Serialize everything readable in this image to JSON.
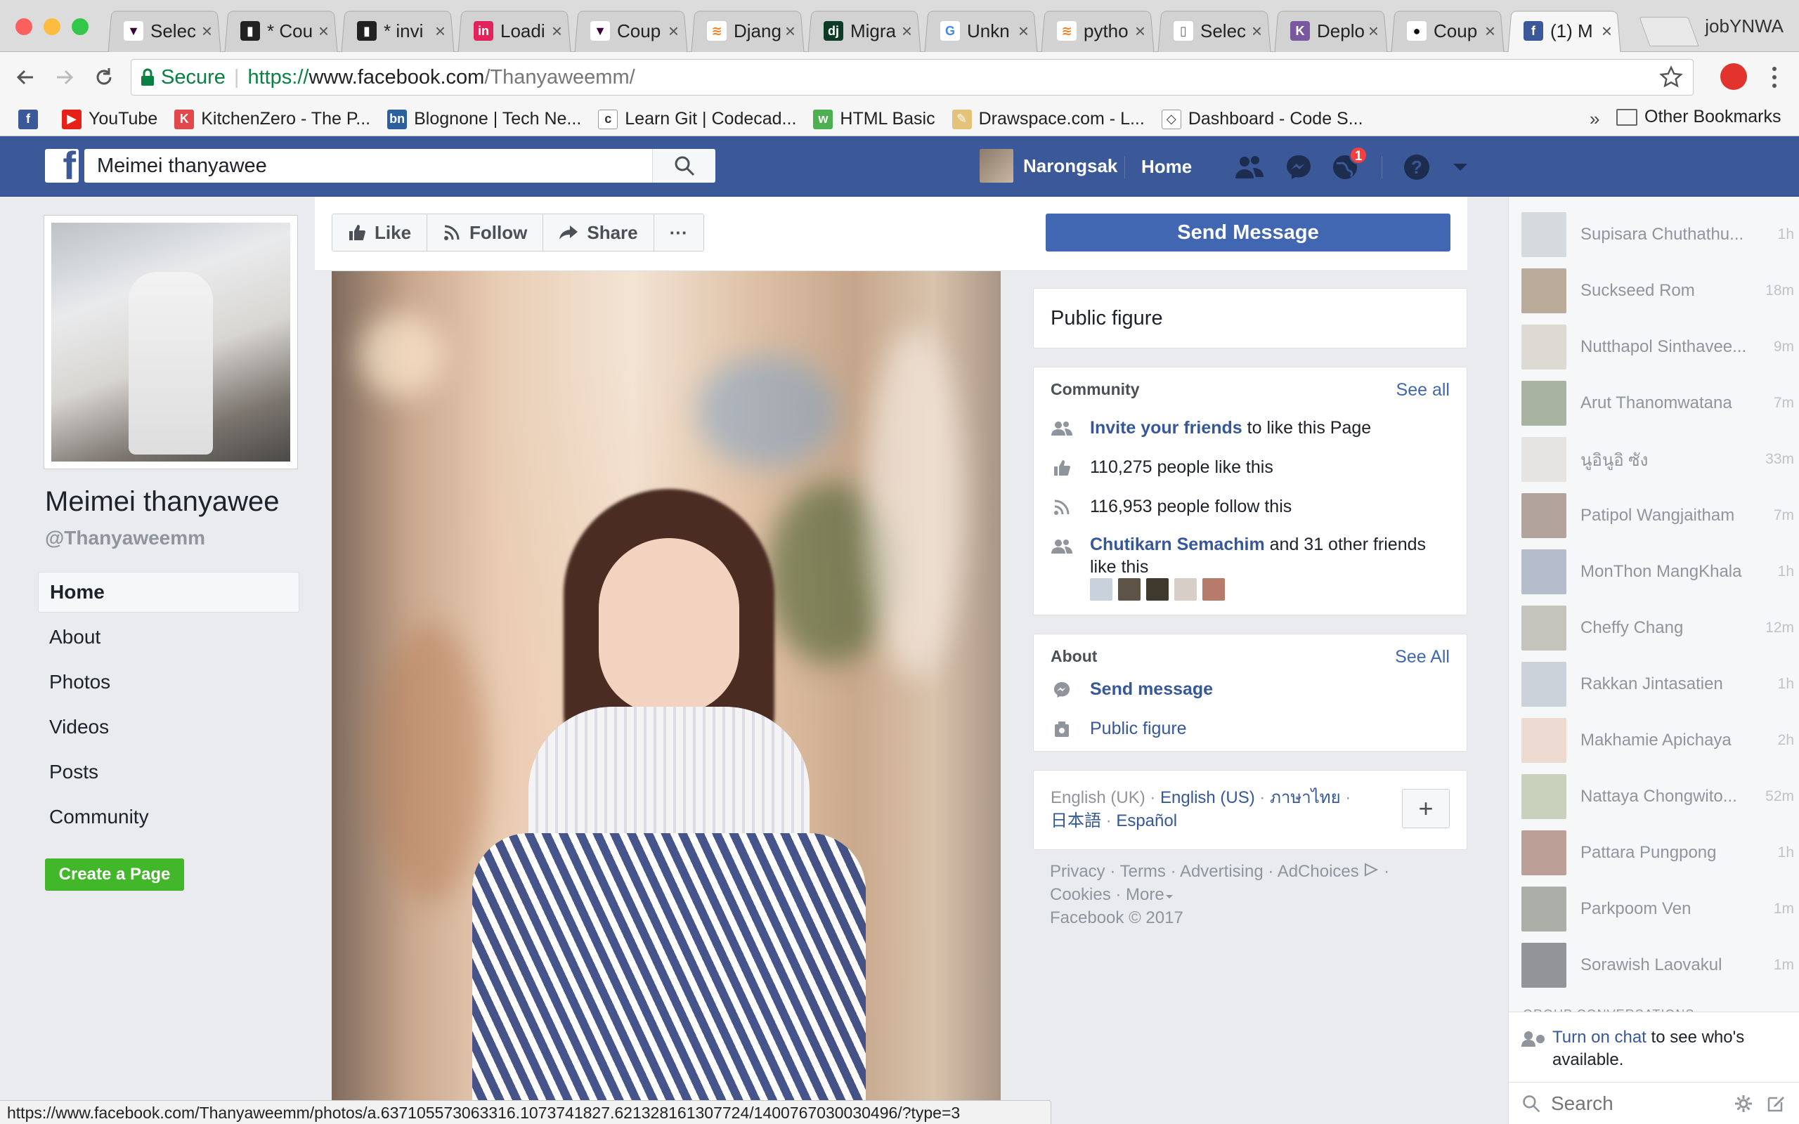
{
  "browser": {
    "profile_name": "jobYNWA",
    "tabs": [
      {
        "title": "Selec",
        "favicon": "fpl-icon",
        "color": "#ffffff",
        "fg": "#37003c",
        "glyph": "▼"
      },
      {
        "title": "* Cou",
        "favicon": "toggl-icon",
        "color": "#222222",
        "fg": "#ffffff",
        "glyph": "▮"
      },
      {
        "title": "* invi",
        "favicon": "toggl-icon",
        "color": "#222222",
        "fg": "#ffffff",
        "glyph": "▮"
      },
      {
        "title": "Loadi",
        "favicon": "invision-icon",
        "color": "#e3245c",
        "fg": "#ffffff",
        "glyph": "in"
      },
      {
        "title": "Coup",
        "favicon": "fpl-icon",
        "color": "#ffffff",
        "fg": "#37003c",
        "glyph": "▼"
      },
      {
        "title": "Djang",
        "favicon": "stackoverflow-icon",
        "color": "#ffffff",
        "fg": "#f48024",
        "glyph": "≋"
      },
      {
        "title": "Migra",
        "favicon": "django-icon",
        "color": "#0c3c26",
        "fg": "#ffffff",
        "glyph": "dj"
      },
      {
        "title": "Unkn",
        "favicon": "google-icon",
        "color": "#ffffff",
        "fg": "#4285f4",
        "glyph": "G"
      },
      {
        "title": "pytho",
        "favicon": "stackoverflow-icon",
        "color": "#ffffff",
        "fg": "#f48024",
        "glyph": "≋"
      },
      {
        "title": "Selec",
        "favicon": "document-icon",
        "color": "#ffffff",
        "fg": "#666666",
        "glyph": "▯"
      },
      {
        "title": "Deplo",
        "favicon": "heroku-icon",
        "color": "#79589f",
        "fg": "#ffffff",
        "glyph": "K"
      },
      {
        "title": "Coup",
        "favicon": "github-icon",
        "color": "#ffffff",
        "fg": "#111111",
        "glyph": "●"
      },
      {
        "title": "(1) M",
        "favicon": "facebook-icon",
        "color": "#3b5998",
        "fg": "#ffffff",
        "glyph": "f",
        "active": true
      }
    ],
    "secure_label": "Secure",
    "url_scheme": "https://",
    "url_host": "www.facebook.com",
    "url_path": "/Thanyaweemm/",
    "bookmarks": [
      {
        "label": "",
        "icon": "facebook-icon",
        "color": "#3b5998",
        "glyph": "f"
      },
      {
        "label": "YouTube",
        "icon": "youtube-icon",
        "color": "#e62117",
        "glyph": "▶"
      },
      {
        "label": "KitchenZero - The P...",
        "icon": "kitchenzero-icon",
        "color": "#e2474b",
        "glyph": "K"
      },
      {
        "label": "Blognone | Tech Ne...",
        "icon": "blognone-icon",
        "color": "#2c5f9e",
        "glyph": "bn"
      },
      {
        "label": "Learn Git | Codecad...",
        "icon": "codecademy-icon",
        "color": "#ffffff",
        "glyph": "c"
      },
      {
        "label": "HTML Basic",
        "icon": "w3schools-icon",
        "color": "#4caf50",
        "glyph": "w"
      },
      {
        "label": "Drawspace.com - L...",
        "icon": "drawspace-icon",
        "color": "#e5c27a",
        "glyph": "✎"
      },
      {
        "label": "Dashboard - Code S...",
        "icon": "codeschool-icon",
        "color": "#ffffff",
        "glyph": "◇"
      }
    ],
    "bookmarks_overflow": "»",
    "other_bookmarks": "Other Bookmarks",
    "status_url": "https://www.facebook.com/Thanyaweemm/photos/a.637105573063316.1073741827.621328161307724/1400767030030496/?type=3"
  },
  "fb_header": {
    "search_value": "Meimei thanyawee",
    "user_name": "Narongsak",
    "home_label": "Home",
    "notification_count": "1"
  },
  "page": {
    "name": "Meimei thanyawee",
    "handle": "@Thanyaweemm",
    "nav": [
      "Home",
      "About",
      "Photos",
      "Videos",
      "Posts",
      "Community"
    ],
    "create_page_label": "Create a Page",
    "actions": {
      "like": "Like",
      "follow": "Follow",
      "share": "Share",
      "more": "···"
    },
    "send_message_label": "Send Message",
    "category": "Public figure"
  },
  "community": {
    "title": "Community",
    "see_all": "See all",
    "invite_link": "Invite your friends",
    "invite_rest": "to like this Page",
    "likes_text": "110,275 people like this",
    "follows_text": "116,953 people follow this",
    "friend_name": "Chutikarn Semachim",
    "friends_rest": "and 31 other friends like this"
  },
  "about": {
    "title": "About",
    "see_all": "See All",
    "send_message": "Send message",
    "category_link": "Public figure"
  },
  "languages": {
    "current": "English (UK)",
    "options": [
      "English (US)",
      "ภาษาไทย",
      "日本語",
      "Español"
    ],
    "add_symbol": "+"
  },
  "footer": {
    "links": [
      "Privacy",
      "Terms",
      "Advertising",
      "AdChoices",
      "Cookies",
      "More"
    ],
    "copyright": "Facebook © 2017"
  },
  "chat": {
    "contacts": [
      {
        "name": "Supisara Chuthathu...",
        "time": "1h",
        "color": "#b9c3c8"
      },
      {
        "name": "Suckseed Rom",
        "time": "18m",
        "color": "#8a6d4f"
      },
      {
        "name": "Nutthapol Sinthavee...",
        "time": "9m",
        "color": "#c9c1b5"
      },
      {
        "name": "Arut Thanomwatana",
        "time": "7m",
        "color": "#6a7b5a"
      },
      {
        "name": "นูอินูอิ ซัง",
        "time": "33m",
        "color": "#d9d6cf"
      },
      {
        "name": "Patipol Wangjaitham",
        "time": "7m",
        "color": "#7a6050"
      },
      {
        "name": "MonThon MangKhala",
        "time": "1h",
        "color": "#7f8ea8"
      },
      {
        "name": "Cheffy Chang",
        "time": "12m",
        "color": "#9a9a8c"
      },
      {
        "name": "Rakkan Jintasatien",
        "time": "1h",
        "color": "#a8b4c0"
      },
      {
        "name": "Makhamie Apichaya",
        "time": "2h",
        "color": "#e6c5b0"
      },
      {
        "name": "Nattaya Chongwito...",
        "time": "52m",
        "color": "#a4b089"
      },
      {
        "name": "Pattara Pungpong",
        "time": "1h",
        "color": "#8c5a48"
      },
      {
        "name": "Parkpoom Ven",
        "time": "1m",
        "color": "#6d7566"
      },
      {
        "name": "Sorawish Laovakul",
        "time": "1m",
        "color": "#3f4448"
      }
    ],
    "group_label": "GROUP CONVERSATIONS",
    "turn_on_link": "Turn on chat",
    "turn_on_rest": "to see who's available.",
    "search_placeholder": "Search"
  }
}
